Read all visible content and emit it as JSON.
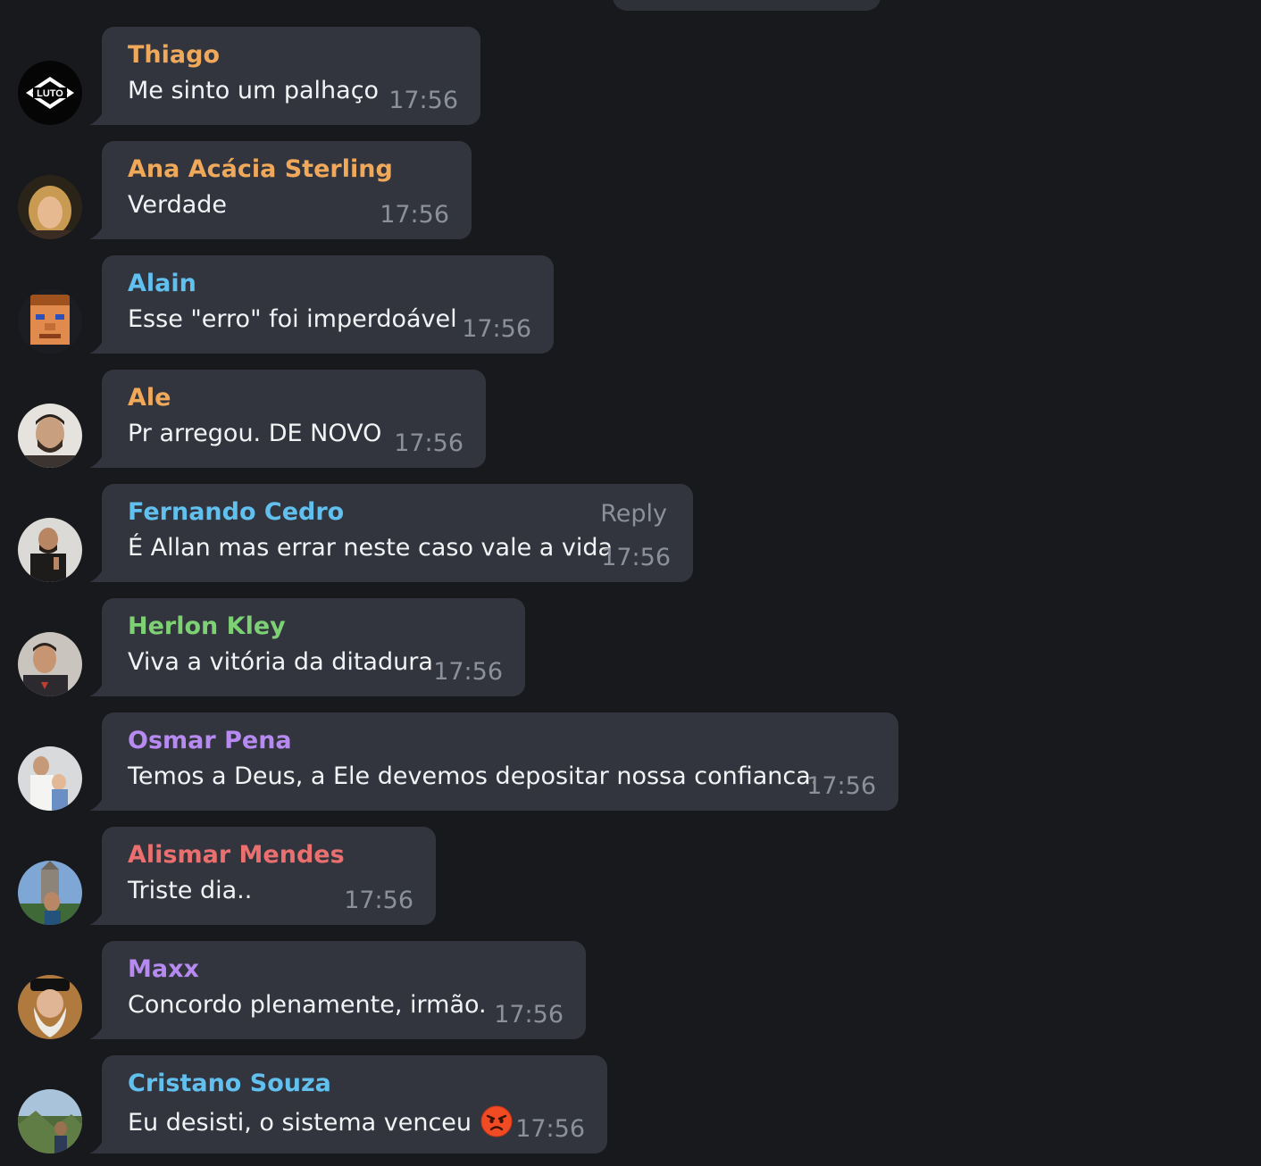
{
  "colors": {
    "background": "#18191c",
    "bubble": "#32353d",
    "timestamp": "#8c9099",
    "message_text": "#f2f3f5"
  },
  "messages": [
    {
      "sender": "Thiago",
      "sender_color": "#f0a95a",
      "text": "Me sinto um palhaço",
      "time": "17:56",
      "avatar": "luto-logo-avatar"
    },
    {
      "sender": "Ana Acácia Sterling",
      "sender_color": "#f0a95a",
      "text": "Verdade",
      "time": "17:56",
      "avatar": "woman-photo-avatar"
    },
    {
      "sender": "Alain",
      "sender_color": "#62c0ef",
      "text": "Esse \"erro\" foi imperdoável",
      "time": "17:56",
      "avatar": "pixel-face-avatar"
    },
    {
      "sender": "Ale",
      "sender_color": "#f0a95a",
      "text": "Pr arregou. DE NOVO",
      "time": "17:56",
      "avatar": "man-photo-avatar"
    },
    {
      "sender": "Fernando Cedro",
      "sender_color": "#62c0ef",
      "text": "É Allan mas errar neste caso vale a vida",
      "time": "17:56",
      "reply_label": "Reply",
      "avatar": "speaker-photo-avatar"
    },
    {
      "sender": "Herlon Kley",
      "sender_color": "#7ed075",
      "text": "Viva a vitória da ditadura",
      "time": "17:56",
      "avatar": "man-photo-avatar"
    },
    {
      "sender": "Osmar Pena",
      "sender_color": "#b68af0",
      "text": "Temos a Deus, a Ele devemos depositar nossa confianca.",
      "time": "17:56",
      "avatar": "family-photo-avatar"
    },
    {
      "sender": "Alismar Mendes",
      "sender_color": "#ea6f6f",
      "text": "Triste dia..",
      "time": "17:56",
      "avatar": "church-photo-avatar"
    },
    {
      "sender": "Maxx",
      "sender_color": "#b68af0",
      "text": "Concordo plenamente, irmão.",
      "time": "17:56",
      "avatar": "bearded-man-photo-avatar"
    },
    {
      "sender": "Cristano Souza",
      "sender_color": "#62c0ef",
      "text": "Eu desisti, o sistema venceu",
      "time": "17:56",
      "emoji": "angry-face-emoji",
      "avatar": "landscape-photo-avatar"
    }
  ]
}
